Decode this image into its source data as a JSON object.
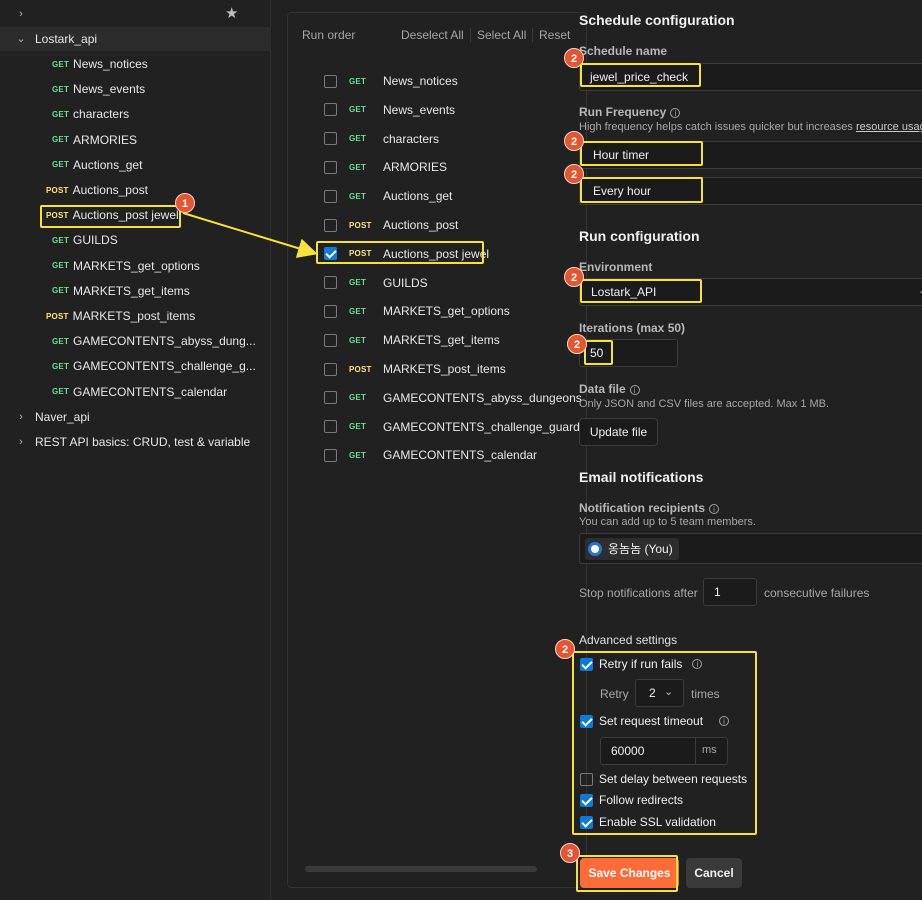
{
  "sidebar": {
    "star_icon": "star-icon",
    "collection": "Lostark_api",
    "requests": [
      {
        "method": "GET",
        "name": "News_notices"
      },
      {
        "method": "GET",
        "name": "News_events"
      },
      {
        "method": "GET",
        "name": "characters"
      },
      {
        "method": "GET",
        "name": "ARMORIES"
      },
      {
        "method": "GET",
        "name": "Auctions_get"
      },
      {
        "method": "POST",
        "name": "Auctions_post"
      },
      {
        "method": "POST",
        "name": "Auctions_post jewel"
      },
      {
        "method": "GET",
        "name": "GUILDS"
      },
      {
        "method": "GET",
        "name": "MARKETS_get_options"
      },
      {
        "method": "GET",
        "name": "MARKETS_get_items"
      },
      {
        "method": "POST",
        "name": "MARKETS_post_items"
      },
      {
        "method": "GET",
        "name": "GAMECONTENTS_abyss_dung..."
      },
      {
        "method": "GET",
        "name": "GAMECONTENTS_challenge_g..."
      },
      {
        "method": "GET",
        "name": "GAMECONTENTS_calendar"
      }
    ],
    "other_collections": [
      "Naver_api",
      "REST API basics: CRUD, test & variable"
    ]
  },
  "run_order": {
    "title": "Run order",
    "deselect_all": "Deselect All",
    "select_all": "Select All",
    "reset": "Reset",
    "items": [
      {
        "method": "GET",
        "name": "News_notices",
        "checked": false
      },
      {
        "method": "GET",
        "name": "News_events",
        "checked": false
      },
      {
        "method": "GET",
        "name": "characters",
        "checked": false
      },
      {
        "method": "GET",
        "name": "ARMORIES",
        "checked": false
      },
      {
        "method": "GET",
        "name": "Auctions_get",
        "checked": false
      },
      {
        "method": "POST",
        "name": "Auctions_post",
        "checked": false
      },
      {
        "method": "POST",
        "name": "Auctions_post jewel",
        "checked": true
      },
      {
        "method": "GET",
        "name": "GUILDS",
        "checked": false
      },
      {
        "method": "GET",
        "name": "MARKETS_get_options",
        "checked": false
      },
      {
        "method": "GET",
        "name": "MARKETS_get_items",
        "checked": false
      },
      {
        "method": "POST",
        "name": "MARKETS_post_items",
        "checked": false
      },
      {
        "method": "GET",
        "name": "GAMECONTENTS_abyss_dungeons",
        "checked": false
      },
      {
        "method": "GET",
        "name": "GAMECONTENTS_challenge_guardian",
        "checked": false
      },
      {
        "method": "GET",
        "name": "GAMECONTENTS_calendar",
        "checked": false
      }
    ]
  },
  "config": {
    "schedule_title": "Schedule configuration",
    "schedule_name_label": "Schedule name",
    "schedule_name_value": "jewel_price_check",
    "run_frequency_label": "Run Frequency",
    "run_frequency_hint": "High frequency helps catch issues quicker but increases",
    "run_frequency_link": "resource usage",
    "frequency_type": "Hour timer",
    "frequency_interval": "Every hour",
    "run_config_title": "Run configuration",
    "environment_label": "Environment",
    "environment_value": "Lostark_API",
    "iterations_label": "Iterations (max 50)",
    "iterations_value": "50",
    "data_file_label": "Data file",
    "data_file_hint": "Only JSON and CSV files are accepted. Max 1 MB.",
    "update_file": "Update file",
    "email_title": "Email notifications",
    "recipients_label": "Notification recipients",
    "recipients_hint": "You can add up to 5 team members.",
    "recipient": "옹놈놈 (You)",
    "stop_prefix": "Stop notifications after",
    "stop_value": "1",
    "stop_suffix": "consecutive failures",
    "advanced_title": "Advanced settings",
    "retry_label": "Retry if run fails",
    "retry_word": "Retry",
    "retry_count": "2",
    "retry_times": "times",
    "timeout_label": "Set request timeout",
    "timeout_value": "60000",
    "timeout_unit": "ms",
    "delay_label": "Set delay between requests",
    "redirects_label": "Follow redirects",
    "ssl_label": "Enable SSL validation",
    "save": "Save Changes",
    "cancel": "Cancel"
  },
  "annotations": {
    "step1": "1",
    "step2": "2",
    "step3": "3",
    "highlight_color": "#f5e23c",
    "badge_color": "#e45532"
  },
  "colors": {
    "get": "#6bdd9a",
    "post": "#ffe47e",
    "primary": "#ff6c37",
    "checkbox": "#0c7bd9"
  }
}
